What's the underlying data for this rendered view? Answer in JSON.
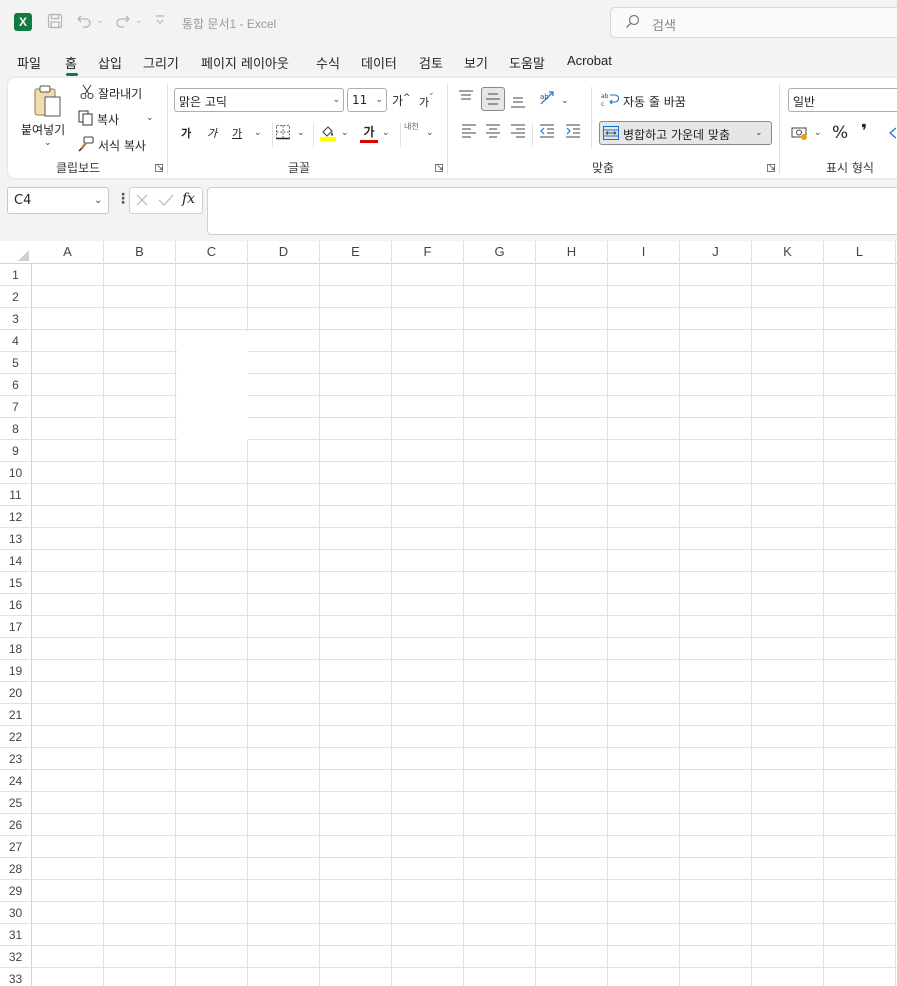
{
  "titlebar": {
    "app_icon_letter": "X",
    "title": "통합 문서1  -  Excel",
    "search_placeholder": "검색"
  },
  "menu_tabs": [
    "파일",
    "홈",
    "삽입",
    "그리기",
    "페이지 레이아웃",
    "수식",
    "데이터",
    "검토",
    "보기",
    "도움말",
    "Acrobat"
  ],
  "active_tab": "홈",
  "ribbon": {
    "clipboard": {
      "paste_label": "붙여넣기",
      "cut_label": "잘라내기",
      "copy_label": "복사",
      "format_painter_label": "서식 복사",
      "group_label": "클립보드"
    },
    "font": {
      "font_name": "맑은 고딕",
      "font_size": "11",
      "grow_label": "가",
      "shrink_label": "가",
      "bold_label": "가",
      "italic_label": "가",
      "underline_label": "가",
      "font_color_label": "가",
      "phonetic_label": "내천",
      "group_label": "글꼴"
    },
    "alignment": {
      "wrap_text_label": "자동 줄 바꿈",
      "merge_center_label": "병합하고 가운데 맞춤",
      "group_label": "맞춤"
    },
    "number": {
      "format_value": "일반",
      "percent_label": "%",
      "comma_label": "❜",
      "group_label": "표시 형식"
    }
  },
  "formula_bar": {
    "name_box": "C4",
    "fx_label": "fx",
    "formula_value": ""
  },
  "sheet": {
    "columns": [
      "A",
      "B",
      "C",
      "D",
      "E",
      "F",
      "G",
      "H",
      "I",
      "J",
      "K",
      "L"
    ],
    "rows": [
      "1",
      "2",
      "3",
      "4",
      "5",
      "6",
      "7",
      "8",
      "9",
      "10",
      "11",
      "12",
      "13",
      "14",
      "15",
      "16",
      "17",
      "18",
      "19",
      "20",
      "21",
      "22",
      "23",
      "24",
      "25",
      "26",
      "27",
      "28",
      "29",
      "30",
      "31",
      "32",
      "33"
    ],
    "merged_range": "C4:C8",
    "selected_cell": "C4"
  },
  "colors": {
    "excel_green": "#107c41",
    "ribbon_bg": "#ffffff",
    "app_bg": "#f3f3f3",
    "gridline": "#e1e1e1",
    "highlight_yellow": "#ffff00",
    "font_red": "#e00000"
  }
}
